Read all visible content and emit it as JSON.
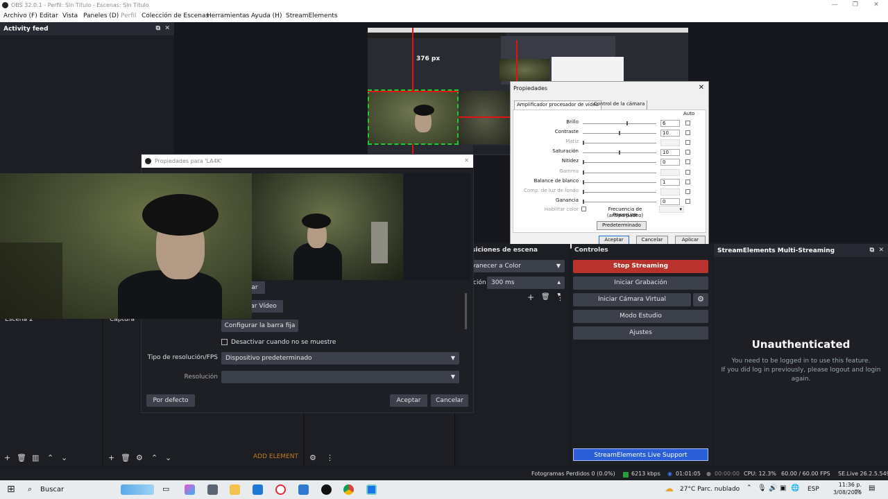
{
  "window": {
    "title": "OBS 32.0.1 - Perfil: Sin Título - Escenas: Sin Título",
    "minimize": "—",
    "maximize": "❐",
    "close": "✕"
  },
  "menu": [
    "Archivo (F)",
    "Editar",
    "Vista",
    "Paneles (D)",
    "Perfil",
    "Colección de Escenas",
    "Herramientas",
    "Ayuda (H)",
    "StreamElements"
  ],
  "activity_feed": {
    "title": "Activity feed",
    "float": "⧉",
    "close": "✕"
  },
  "preview": {
    "measure_label": "376 px"
  },
  "cam_props": {
    "title": "Propiedades",
    "close": "✕",
    "tabs": [
      "Amplificador procesador de vídeo",
      "Control de la cámara"
    ],
    "auto_label": "Auto",
    "rows": [
      {
        "label": "Brillo",
        "value": "6",
        "enabled": true,
        "level": 0.61
      },
      {
        "label": "Contraste",
        "value": "10",
        "enabled": true,
        "level": 0.5
      },
      {
        "label": "Matiz",
        "value": "",
        "enabled": false,
        "level": 0.0
      },
      {
        "label": "Saturación",
        "value": "10",
        "enabled": true,
        "level": 0.5
      },
      {
        "label": "Nitidez",
        "value": "0",
        "enabled": true,
        "level": 0.0
      },
      {
        "label": "Gamma",
        "value": "",
        "enabled": false,
        "level": 0.0
      },
      {
        "label": "Balance de blanco",
        "value": "1",
        "enabled": true,
        "level": 0.0
      },
      {
        "label": "Comp. de luz de fondo",
        "value": "",
        "enabled": false,
        "level": 0.0
      },
      {
        "label": "Ganancia",
        "value": "0",
        "enabled": true,
        "level": 0.0
      }
    ],
    "habilitar_color": "Habilitar color",
    "powerline_label_1": "Frecuencia de PowerLine",
    "powerline_label_2": "(antiparpadeo)",
    "default_btn": "Predeterminado",
    "ok": "Aceptar",
    "cancel": "Cancelar",
    "apply": "Aplicar"
  },
  "src_props": {
    "title": "Propiedades para 'LA4K'",
    "close": "✕",
    "btn_partial_1": "ar",
    "btn_partial_2": "ar Vídeo",
    "toolbar_btn": "Configurar la barra fija",
    "checkbox_label": "Desactivar cuando no se muestre",
    "res_type_label": "Tipo de resolución/FPS",
    "res_type_value": "Dispositivo predeterminado",
    "resolution_label": "Resolución",
    "resolution_value": "",
    "defaults": "Por defecto",
    "ok": "Aceptar",
    "cancel": "Cancelar"
  },
  "scenes": {
    "item": "Escena 2"
  },
  "sources": {
    "item": "Captura"
  },
  "transitions": {
    "header": "siciones de escena",
    "transition": "vanecer a Color",
    "duration_label": "ción",
    "duration": "300 ms"
  },
  "controls": {
    "header": "Controles",
    "buttons": [
      "Stop Streaming",
      "Iniciar Grabación",
      "Iniciar Cámara Virtual",
      "Modo Estudio",
      "Ajustes"
    ],
    "gear": "⚙",
    "support": "StreamElements Live Support",
    "streaming_color": "#b9332c"
  },
  "se_dock": {
    "title": "StreamElements Multi-Streaming",
    "heading": "Unauthenticated",
    "line1": "You need to be logged in to use this feature.",
    "line2": "If you did log in previously, please logout and login",
    "line3": "again."
  },
  "mixer_toolbar": {
    "add_element": "ADD ELEMENT"
  },
  "status": {
    "dropped": "Fotogramas Perdidos 0 (0.0%)",
    "kbps": "6213 kbps",
    "stream_time": "01:01:05",
    "rec_time": "00:00:00",
    "cpu": "CPU: 12.3%",
    "fps": "60.00 / 60.00 FPS",
    "version": "SE.Live 26.2.5.549"
  },
  "taskbar": {
    "search": "Buscar",
    "weather": "27°C  Parc. nublado",
    "lang": "ESP",
    "time": "11:36 p. m.",
    "date": "3/08/2026"
  }
}
